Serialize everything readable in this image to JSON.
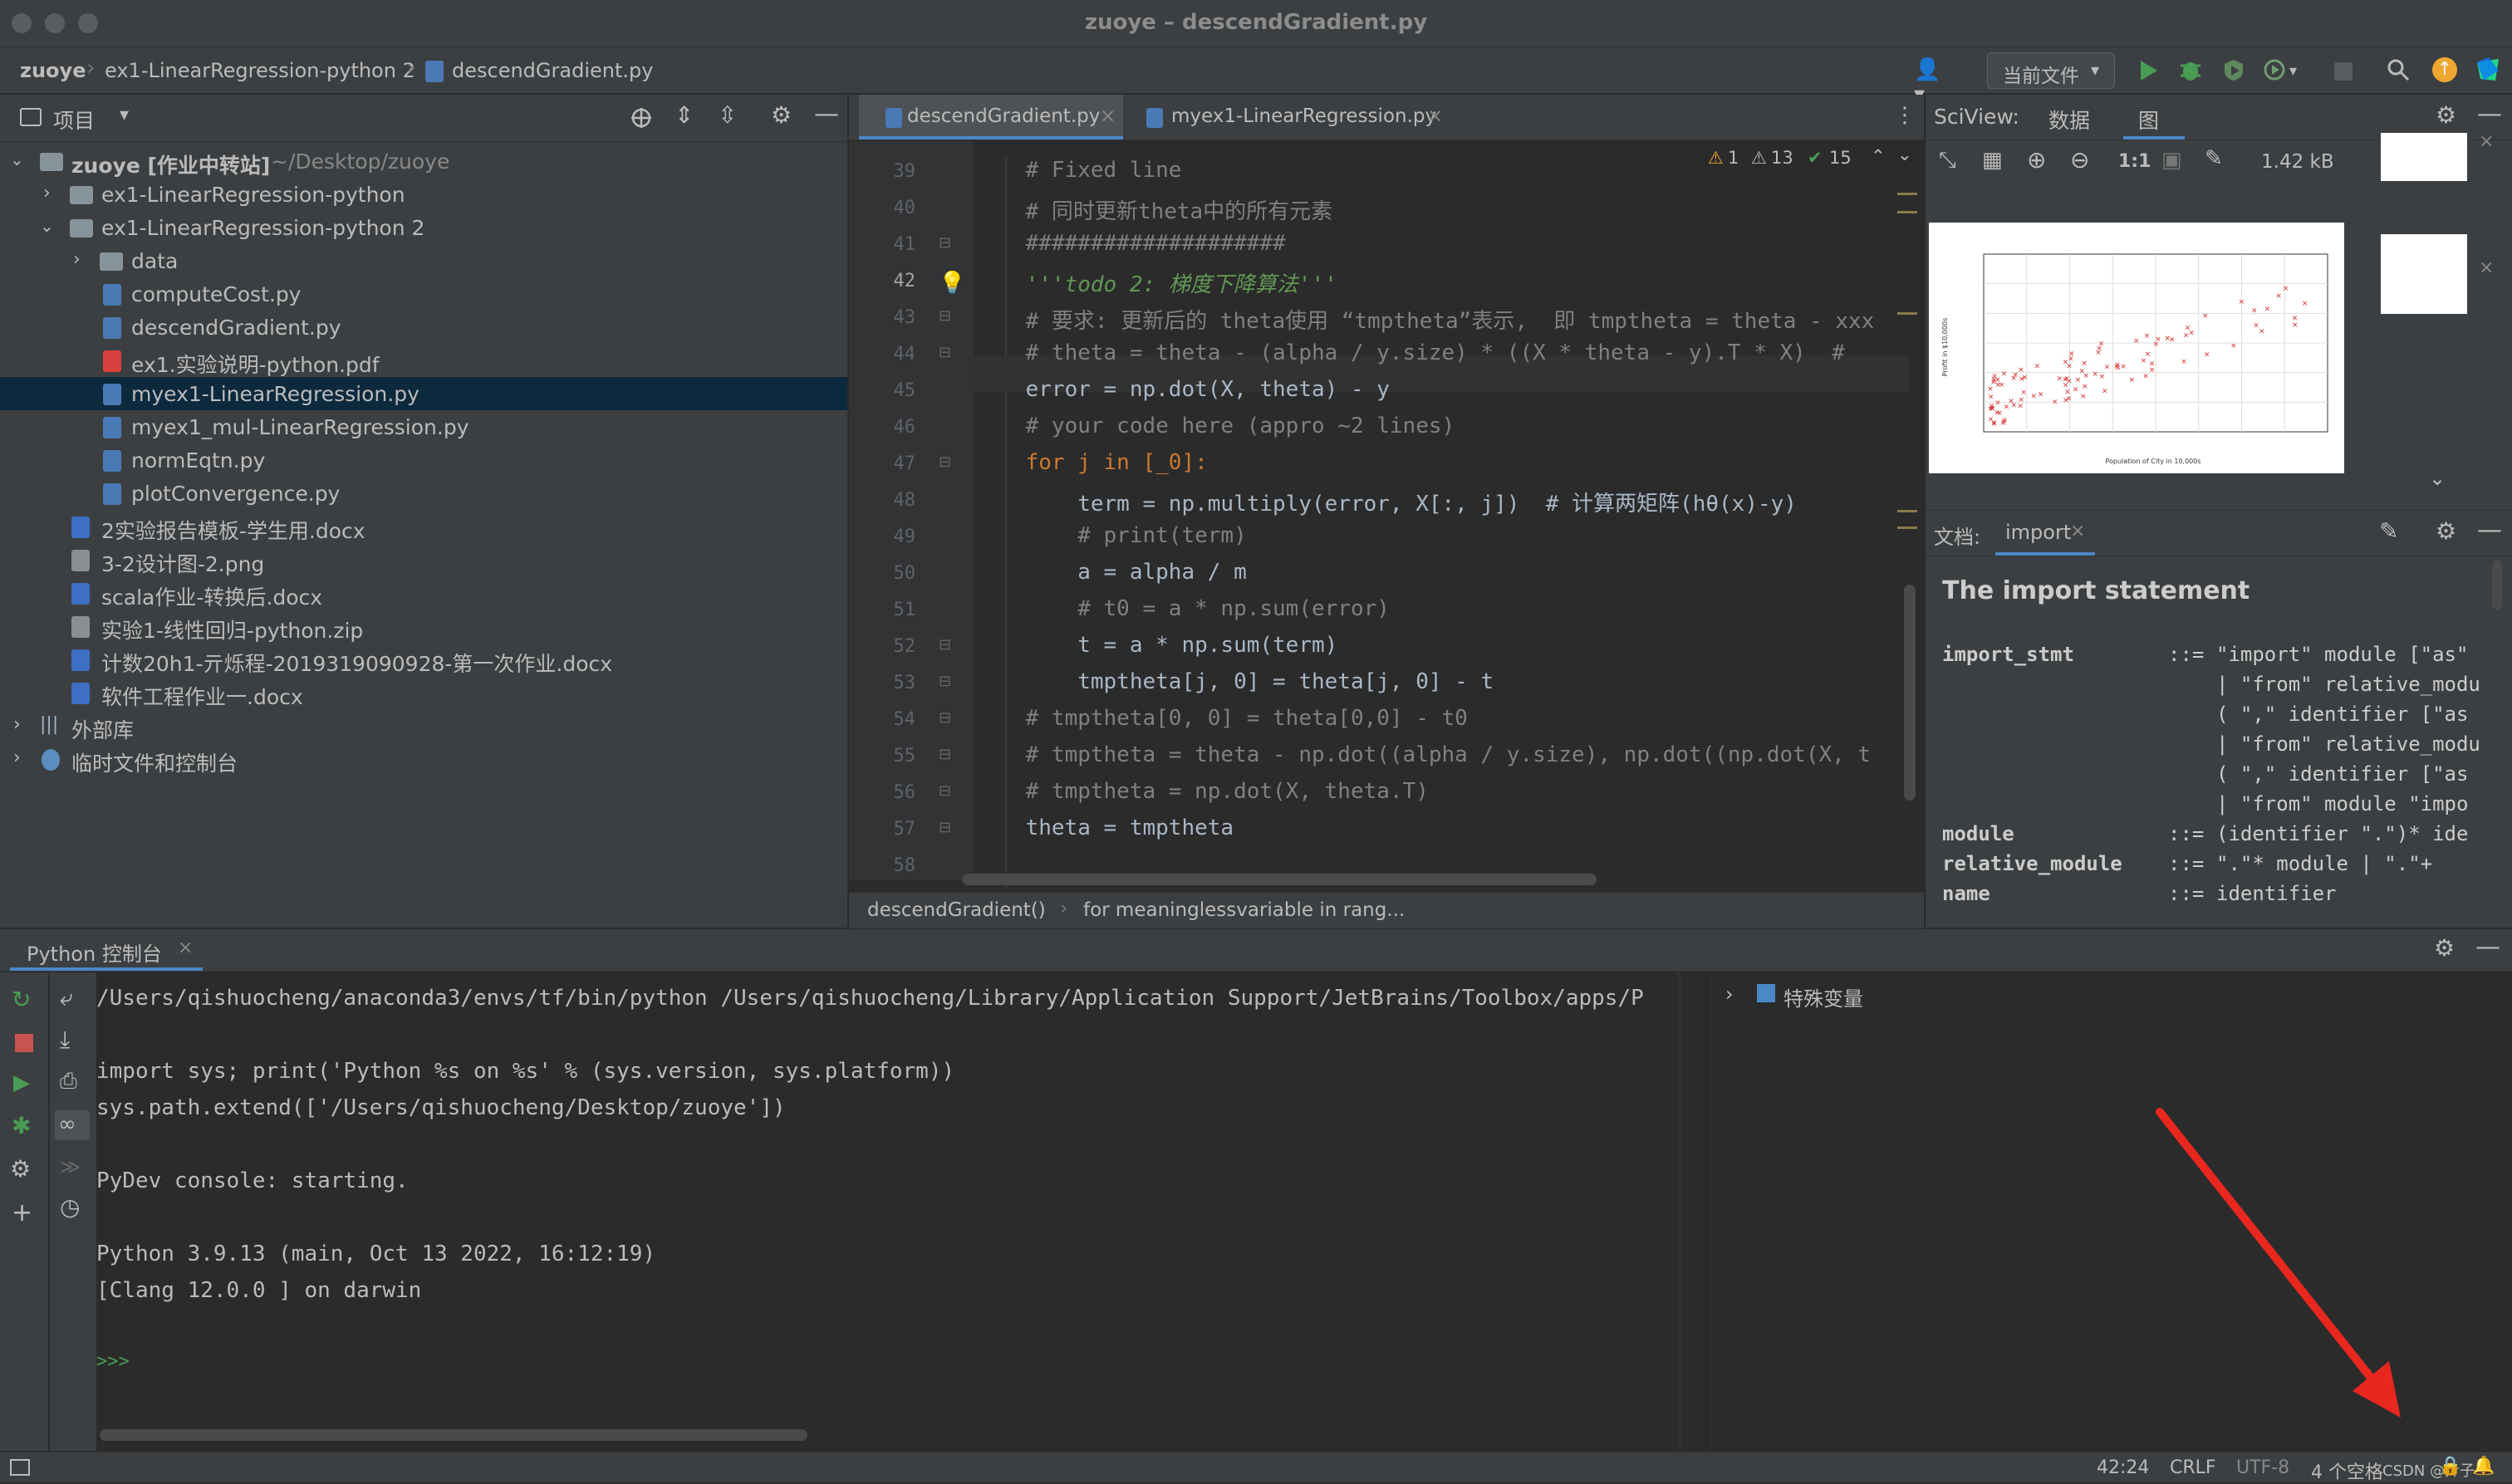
{
  "window": {
    "title": "zuoye – descendGradient.py"
  },
  "navbar": {
    "breadcrumbs": [
      "zuoye",
      "ex1-LinearRegression-python 2",
      "descendGradient.py"
    ],
    "run_config": "当前文件"
  },
  "project": {
    "header_label": "项目",
    "tree": [
      {
        "label": "zuoye [作业中转站]",
        "suffix": "~/Desktop/zuoye"
      },
      {
        "label": "ex1-LinearRegression-python"
      },
      {
        "label": "ex1-LinearRegression-python 2"
      },
      {
        "label": "data"
      },
      {
        "label": "computeCost.py"
      },
      {
        "label": "descendGradient.py"
      },
      {
        "label": "ex1.实验说明-python.pdf"
      },
      {
        "label": "myex1-LinearRegression.py"
      },
      {
        "label": "myex1_mul-LinearRegression.py"
      },
      {
        "label": "normEqtn.py"
      },
      {
        "label": "plotConvergence.py"
      },
      {
        "label": "2实验报告模板-学生用.docx"
      },
      {
        "label": "3-2设计图-2.png"
      },
      {
        "label": "scala作业-转换后.docx"
      },
      {
        "label": "实验1-线性回归-python.zip"
      },
      {
        "label": "计数20h1-亓烁程-2019319090928-第一次作业.docx"
      },
      {
        "label": "软件工程作业一.docx"
      },
      {
        "label": "外部库"
      },
      {
        "label": "临时文件和控制台"
      }
    ]
  },
  "editor": {
    "tabs": [
      "descendGradient.py",
      "myex1-LinearRegression.py"
    ],
    "inspections": {
      "warnings": "1",
      "weak_warnings": "13",
      "typos": "15"
    },
    "lines": [
      {
        "n": "39",
        "text": "    # Fixed line"
      },
      {
        "n": "40",
        "text": "    # 同时更新theta中的所有元素"
      },
      {
        "n": "41",
        "text": "    ####################"
      },
      {
        "n": "42",
        "text": "    '''todo 2: 梯度下降算法'''"
      },
      {
        "n": "43",
        "text": "    # 要求: 更新后的 theta使用 “tmptheta”表示,  即 tmptheta = theta - xxx"
      },
      {
        "n": "44",
        "text": "    # theta = theta - (alpha / y.size) * ((X * theta - y).T * X)  #"
      },
      {
        "n": "45",
        "text": "    error = np.dot(X, theta) - y"
      },
      {
        "n": "46",
        "text": "    # your code here (appro ~2 lines)"
      },
      {
        "n": "47",
        "text": "    for j in [_0]:"
      },
      {
        "n": "48",
        "text": "        term = np.multiply(error, X[:, j])  # 计算两矩阵(hθ(x)-y)"
      },
      {
        "n": "49",
        "text": "        # print(term)"
      },
      {
        "n": "50",
        "text": "        a = alpha / m"
      },
      {
        "n": "51",
        "text": "        # t0 = a * np.sum(error)"
      },
      {
        "n": "52",
        "text": "        t = a * np.sum(term)"
      },
      {
        "n": "53",
        "text": "        tmptheta[j, 0] = theta[j, 0] - t"
      },
      {
        "n": "54",
        "text": "    # tmptheta[0, 0] = theta[0,0] - t0"
      },
      {
        "n": "55",
        "text": "    # tmptheta = theta - np.dot((alpha / y.size), np.dot((np.dot(X, t"
      },
      {
        "n": "56",
        "text": "    # tmptheta = np.dot(X, theta.T)"
      },
      {
        "n": "57",
        "text": "    theta = tmptheta"
      },
      {
        "n": "58",
        "text": ""
      }
    ],
    "breadcrumb": [
      "descendGradient()",
      "for meaninglessvariable in rang..."
    ]
  },
  "sciview": {
    "title": "SciView:",
    "tabs": [
      "数据",
      "图"
    ],
    "file_size": "1.42 kB",
    "zoom_label": "1:1",
    "plot_xlabel": "Population of City in 10,000s",
    "plot_ylabel": "Profit in $10,000s"
  },
  "docs": {
    "label": "文档:",
    "tab": "import",
    "heading": "The import statement",
    "rows": [
      {
        "name": "import_stmt",
        "op": "::=",
        "rule": "\"import\" module [\"as\""
      },
      {
        "name": "",
        "op": "",
        "rule": "| \"from\" relative_modu"
      },
      {
        "name": "",
        "op": "",
        "rule": "( \",\" identifier [\"as"
      },
      {
        "name": "",
        "op": "",
        "rule": "| \"from\" relative_modu"
      },
      {
        "name": "",
        "op": "",
        "rule": "( \",\" identifier [\"as"
      },
      {
        "name": "",
        "op": "",
        "rule": "| \"from\" module \"impo"
      },
      {
        "name": "module",
        "op": "::=",
        "rule": "(identifier \".\")* ide"
      },
      {
        "name": "relative_module",
        "op": "::=",
        "rule": "\".\"* module | \".\"+"
      },
      {
        "name": "name",
        "op": "::=",
        "rule": "identifier"
      }
    ]
  },
  "console": {
    "tab": "Python 控制台",
    "lines": [
      "/Users/qishuocheng/anaconda3/envs/tf/bin/python /Users/qishuocheng/Library/Application Support/JetBrains/Toolbox/apps/P",
      "",
      "import sys; print('Python %s on %s' % (sys.version, sys.platform))",
      "sys.path.extend(['/Users/qishuocheng/Desktop/zuoye'])",
      "",
      "PyDev console: starting.",
      "",
      "Python 3.9.13 (main, Oct 13 2022, 16:12:19)",
      "[Clang 12.0.0 ] on darwin",
      "",
      ">>>"
    ],
    "variables_label": "特殊变量"
  },
  "status": {
    "position": "42:24",
    "line_sep": "CRLF",
    "encoding": "UTF-8",
    "indent": "4 个空格",
    "watermark": "CSDN @亓子"
  },
  "colors": {
    "arrow": "#e8271f",
    "selection": "#0d293e",
    "accent_green": "#499c54"
  }
}
